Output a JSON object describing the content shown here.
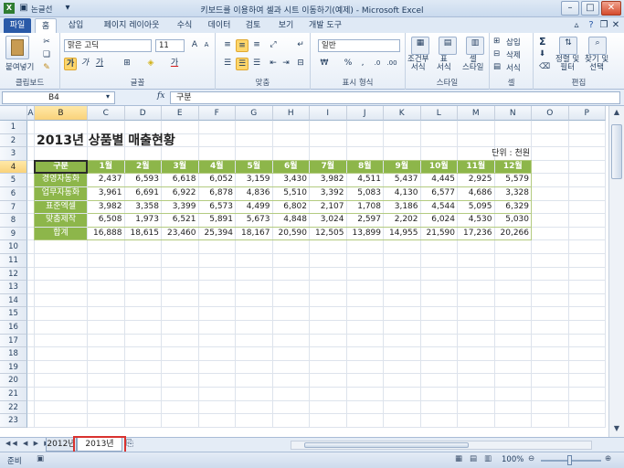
{
  "window": {
    "title": "키보드를 이용하여 셀과 시트 이동하기(예제) - Microsoft Excel",
    "quick_access": "논글선"
  },
  "ribbon_tabs": [
    "파일",
    "홈",
    "삽입",
    "페이지 레이아웃",
    "수식",
    "데이터",
    "검토",
    "보기",
    "개발 도구"
  ],
  "active_tab": "홈",
  "ribbon": {
    "clipboard": {
      "paste": "붙여넣기",
      "label": "클립보드"
    },
    "font": {
      "name": "맑은 고딕",
      "size": "11",
      "label": "글꼴",
      "bold": "가",
      "italic": "가",
      "underline": "가",
      "font_color": "가"
    },
    "alignment": {
      "label": "맞춤"
    },
    "number": {
      "format": "일반",
      "label": "표시 형식",
      "percent": "%",
      "comma": ","
    },
    "styles": {
      "conditional": "조건부\n서식",
      "table": "표\n서식",
      "cell_style": "셀\n스타일",
      "label": "스타일"
    },
    "cells": {
      "insert": "삽입",
      "delete": "삭제",
      "format": "서식",
      "label": "셀"
    },
    "editing": {
      "sort": "정렬 및\n필터",
      "find": "찾기 및\n선택",
      "label": "편집",
      "sum": "Σ"
    }
  },
  "formula_bar": {
    "name_box": "B4",
    "fx": "fx",
    "content": "구분"
  },
  "columns": [
    "A",
    "B",
    "C",
    "D",
    "E",
    "F",
    "G",
    "H",
    "I",
    "J",
    "K",
    "L",
    "M",
    "N",
    "O",
    "P"
  ],
  "selected_col": "B",
  "rows": [
    "1",
    "2",
    "3",
    "4",
    "5",
    "6",
    "7",
    "8",
    "9",
    "10",
    "11",
    "12",
    "13",
    "14",
    "15",
    "16",
    "17",
    "18",
    "19",
    "20",
    "21",
    "22",
    "23"
  ],
  "selected_row": "4",
  "sheet": {
    "title": "2013년 상품별 매출현황",
    "unit": "단위 : 천원",
    "header": [
      "구분",
      "1월",
      "2월",
      "3월",
      "4월",
      "5월",
      "6월",
      "7월",
      "8월",
      "9월",
      "10월",
      "11월",
      "12월"
    ],
    "body": [
      [
        "경영자동화",
        "2,437",
        "6,593",
        "6,618",
        "6,052",
        "3,159",
        "3,430",
        "3,982",
        "4,511",
        "5,437",
        "4,445",
        "2,925",
        "5,579"
      ],
      [
        "업무자동화",
        "3,961",
        "6,691",
        "6,922",
        "6,878",
        "4,836",
        "5,510",
        "3,392",
        "5,083",
        "4,130",
        "6,577",
        "4,686",
        "3,328"
      ],
      [
        "표준엑셀",
        "3,982",
        "3,358",
        "3,399",
        "6,573",
        "4,499",
        "6,802",
        "2,107",
        "1,708",
        "3,186",
        "4,544",
        "5,095",
        "6,329"
      ],
      [
        "맞춤제작",
        "6,508",
        "1,973",
        "6,521",
        "5,891",
        "5,673",
        "4,848",
        "3,024",
        "2,597",
        "2,202",
        "6,024",
        "4,530",
        "5,030"
      ],
      [
        "합계",
        "16,888",
        "18,615",
        "23,460",
        "25,394",
        "18,167",
        "20,590",
        "12,505",
        "13,899",
        "14,955",
        "21,590",
        "17,236",
        "20,266"
      ]
    ]
  },
  "sheet_tabs": [
    "2012년",
    "2013년"
  ],
  "active_sheet": "2013년",
  "status": {
    "ready": "준비",
    "zoom": "100%"
  },
  "colors": {
    "header_green": "#8db64a",
    "highlight": "#d9322f",
    "accent": "#2a5aa8"
  }
}
